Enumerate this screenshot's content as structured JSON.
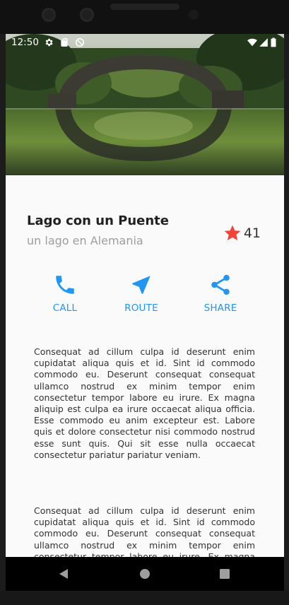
{
  "status_bar": {
    "time": "12:50",
    "icons_left": [
      "gear-icon",
      "sd-card-icon",
      "dnd-icon"
    ],
    "icons_right": [
      "wifi-icon",
      "signal-icon",
      "battery-icon"
    ]
  },
  "place": {
    "title": "Lago con un Puente",
    "subtitle": "un lago en Alemania",
    "rating": "41"
  },
  "actions": {
    "call_label": "CALL",
    "route_label": "ROUTE",
    "share_label": "SHARE"
  },
  "description": {
    "para1": "Consequat ad cillum culpa id deserunt enim cupidatat aliqua quis et id. Sint id commodo commodo eu. Deserunt consequat consequat ullamco nostrud ex minim tempor enim consectetur tempor labore eu irure. Ex magna aliquip est culpa ea irure occaecat aliqua officia. Esse commodo eu anim excepteur est. Labore quis et dolore consectetur nisi commodo nostrud esse sunt quis. Qui sit esse nulla occaecat consectetur pariatur pariatur veniam.",
    "para2": "Consequat ad cillum culpa id deserunt enim cupidatat aliqua quis et id. Sint id commodo commodo eu. Deserunt consequat consequat ullamco nostrud ex minim tempor enim consectetur tempor labore eu irure. Ex magna aliquip est culpa ea irure occaecat aliqua officia. Esse commodo eu anim excepteur est. Labore quis et dolore consectetur nisi commodo nostrud esse sunt quis. Qui sit esse nulla occaecat consectetur pariatur pariatur veniam."
  },
  "colors": {
    "accent": "#2196f3",
    "star": "#f44336"
  }
}
